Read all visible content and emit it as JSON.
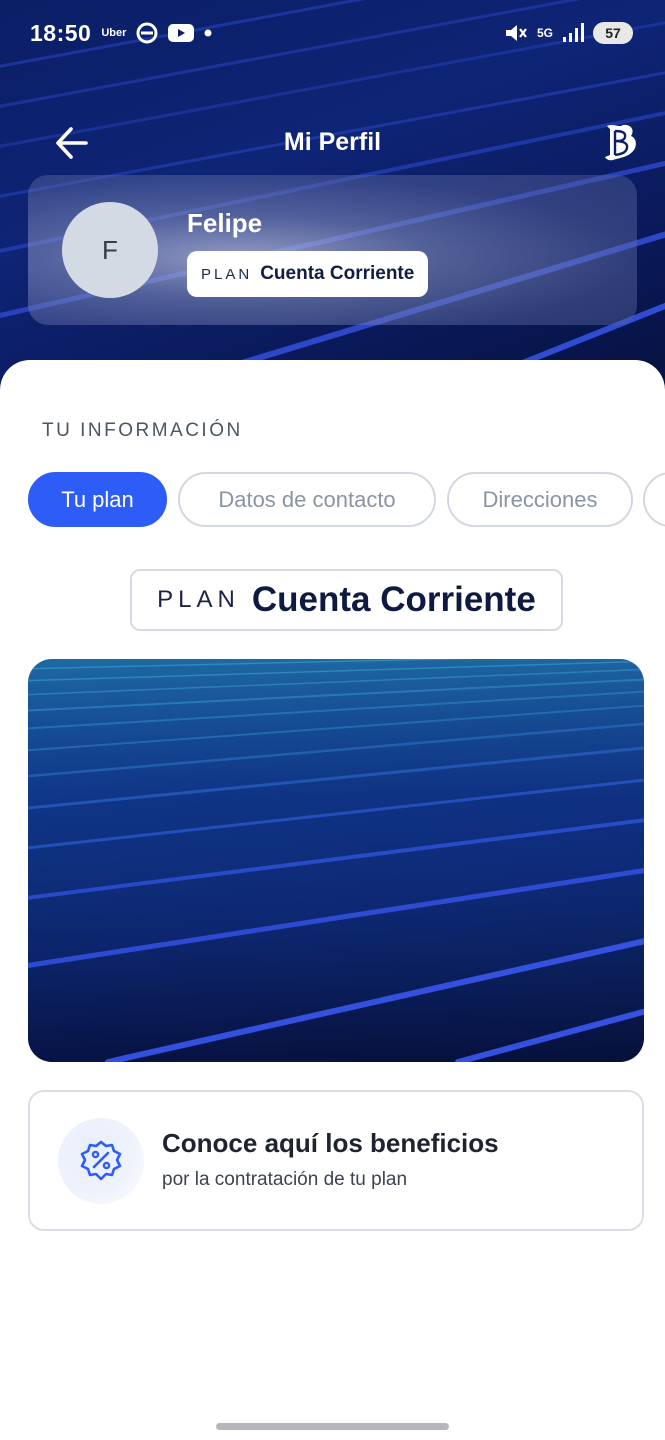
{
  "status_bar": {
    "time": "18:50",
    "uber_label": "Uber",
    "network": "5G",
    "battery": "57"
  },
  "header": {
    "title": "Mi Perfil",
    "back_icon": "arrow-left-icon",
    "brand_icon": "newspaper-logo-icon"
  },
  "profile": {
    "avatar_initial": "F",
    "name": "Felipe",
    "plan_keyword": "PLAN",
    "plan_name": "Cuenta Corriente"
  },
  "info": {
    "section_title": "TU INFORMACIÓN",
    "tabs": [
      {
        "label": "Tu plan",
        "active": true
      },
      {
        "label": "Datos de contacto",
        "active": false
      },
      {
        "label": "Direcciones",
        "active": false
      },
      {
        "label": "",
        "active": false
      }
    ]
  },
  "plan": {
    "keyword": "PLAN",
    "name": "Cuenta Corriente"
  },
  "benefits": {
    "title": "Conoce aquí los beneficios",
    "subtitle": "por la contratación de tu plan",
    "icon": "discount-badge-icon"
  },
  "colors": {
    "primary": "#2d5cf6",
    "hero_dark": "#0b1f66",
    "accent_stripe": "#3552e8"
  }
}
